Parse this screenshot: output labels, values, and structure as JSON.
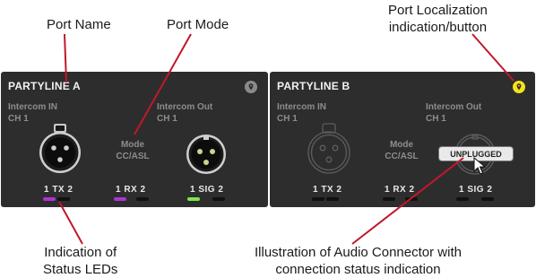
{
  "callouts": {
    "port_name": "Port Name",
    "port_mode": "Port Mode",
    "port_localization": "Port Localization\nindication/button",
    "status_leds": "Indication of\nStatus LEDs",
    "audio_connector": "Illustration of Audio Connector with\nconnection status indication"
  },
  "colors": {
    "panel_bg": "#2d2d2d",
    "led_purple": "#b033d6",
    "led_green": "#7ee84a",
    "led_off": "#111111",
    "localization_active": "#f5e21a",
    "callout_line": "#c0182a"
  },
  "ports": [
    {
      "name": "PARTYLINE A",
      "intercom_in": "Intercom IN",
      "intercom_in_ch": "CH 1",
      "intercom_out": "Intercom Out",
      "intercom_out_ch": "CH 1",
      "mode_label": "Mode",
      "mode_value": "CC/ASL",
      "localization_icon": "location-pin-icon",
      "localization_active": false,
      "leds": [
        {
          "label": "1 TX 2",
          "states": [
            "purple",
            "off"
          ]
        },
        {
          "label": "1 RX 2",
          "states": [
            "purple",
            "off"
          ]
        },
        {
          "label": "1 SIG 2",
          "states": [
            "green",
            "off"
          ]
        }
      ],
      "connector_in": "xlr-female-connector-icon",
      "connector_out": "xlr-male-connector-icon",
      "connected": true
    },
    {
      "name": "PARTYLINE B",
      "intercom_in": "Intercom IN",
      "intercom_in_ch": "CH 1",
      "intercom_out": "Intercom Out",
      "intercom_out_ch": "CH 1",
      "mode_label": "Mode",
      "mode_value": "CC/ASL",
      "localization_icon": "location-pin-icon",
      "localization_active": true,
      "leds": [
        {
          "label": "1 TX 2",
          "states": [
            "off",
            "off"
          ]
        },
        {
          "label": "1 RX 2",
          "states": [
            "off",
            "off"
          ]
        },
        {
          "label": "1 SIG 2",
          "states": [
            "off",
            "off"
          ]
        }
      ],
      "connector_in": "xlr-female-connector-icon",
      "connector_out": "xlr-male-connector-icon",
      "connected": false,
      "status_tooltip": "UNPLUGGED"
    }
  ]
}
